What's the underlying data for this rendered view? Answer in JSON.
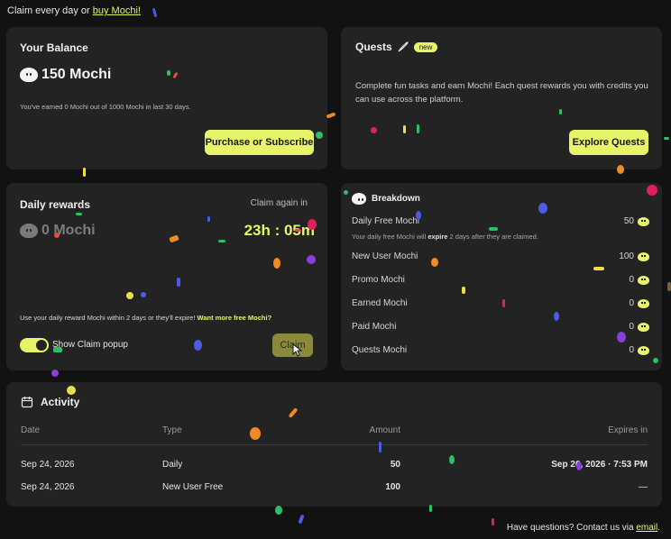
{
  "top": {
    "prefix": "Claim every day or ",
    "link": "buy Mochi!"
  },
  "balance": {
    "title": "Your Balance",
    "amount": "150 Mochi",
    "note": "You've earned 0 Mochi out of 1000 Mochi in last 30 days.",
    "button": "Purchase or Subscribe"
  },
  "quests": {
    "title": "Quests",
    "badge": "new",
    "description": "Complete fun tasks and earn Mochi! Each quest rewards you with credits you can use across the platform.",
    "button": "Explore Quests"
  },
  "daily": {
    "title": "Daily rewards",
    "amount": "0 Mochi",
    "claim_again_label": "Claim again in",
    "countdown": "23h : 05m",
    "warning": "Use your daily reward Mochi within 2 days or they'll expire!",
    "warning_link": "Want more free Mochi?",
    "toggle_label": "Show Claim popup",
    "claim_button": "Claim",
    "toggle_on": true
  },
  "breakdown": {
    "title": "Breakdown",
    "rows": [
      {
        "label": "Daily Free Mochi",
        "value": "50"
      },
      {
        "label": "New User Mochi",
        "value": "100"
      },
      {
        "label": "Promo Mochi",
        "value": "0"
      },
      {
        "label": "Earned Mochi",
        "value": "0"
      },
      {
        "label": "Paid Mochi",
        "value": "0"
      },
      {
        "label": "Quests Mochi",
        "value": "0"
      }
    ],
    "note_prefix": "Your daily free Mochi will ",
    "note_bold": "expire",
    "note_suffix": " 2 days after they are claimed."
  },
  "activity": {
    "title": "Activity",
    "headers": {
      "date": "Date",
      "type": "Type",
      "amount": "Amount",
      "expires": "Expires in"
    },
    "rows": [
      {
        "date": "Sep 24, 2026",
        "type": "Daily",
        "amount": "50",
        "expires": "Sep 26, 2026 · 7:53 PM"
      },
      {
        "date": "Sep 24, 2026",
        "type": "New User Free",
        "amount": "100",
        "expires": "—"
      }
    ]
  },
  "footer": {
    "prefix": "Have questions? Contact us via ",
    "link": "email",
    "suffix": "."
  },
  "colors": {
    "accent": "#e7f46a",
    "card": "#232323",
    "background": "#121212"
  }
}
